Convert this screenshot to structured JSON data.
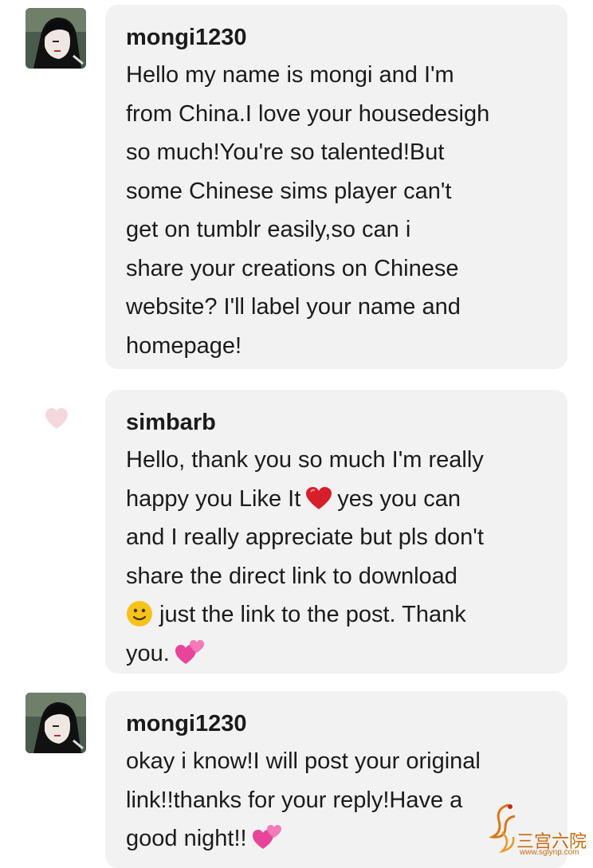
{
  "messages": [
    {
      "username": "mongi1230",
      "avatar_icon": "user-avatar",
      "lines": [
        "Hello my name is mongi and I'm",
        "from China.I love your housedesigh",
        "so much!You're so talented!But",
        "some Chinese sims  player can't",
        "get on tumblr easily,so can i",
        "share your creations on Chinese",
        "website? I'll label your name and",
        "homepage!"
      ]
    },
    {
      "username": "simbarb",
      "avatar_icon": "heart-icon",
      "lines": [
        "Hello, thank you so much I'm really",
        "happy you Like It",
        "yes you can",
        "and I really appreciate but pls don't",
        "share the direct link to download",
        "just the link to the post. Thank",
        "you."
      ],
      "emoji": [
        "red-heart-emoji",
        "slight-smile-emoji",
        "two-hearts-emoji"
      ]
    },
    {
      "username": "mongi1230",
      "avatar_icon": "user-avatar",
      "lines": [
        "okay i know!I will post your original",
        "link!!thanks for your reply!Have a",
        "good night!!"
      ],
      "emoji": [
        "two-hearts-emoji"
      ]
    }
  ],
  "watermark": {
    "text": "三宫六院",
    "url": "www.sglynp.com"
  },
  "colors": {
    "bubble_bg": "#f2f2f2",
    "text": "#1b1b1b",
    "heart_mark": "#f4d8de",
    "watermark": "#c86a12"
  }
}
